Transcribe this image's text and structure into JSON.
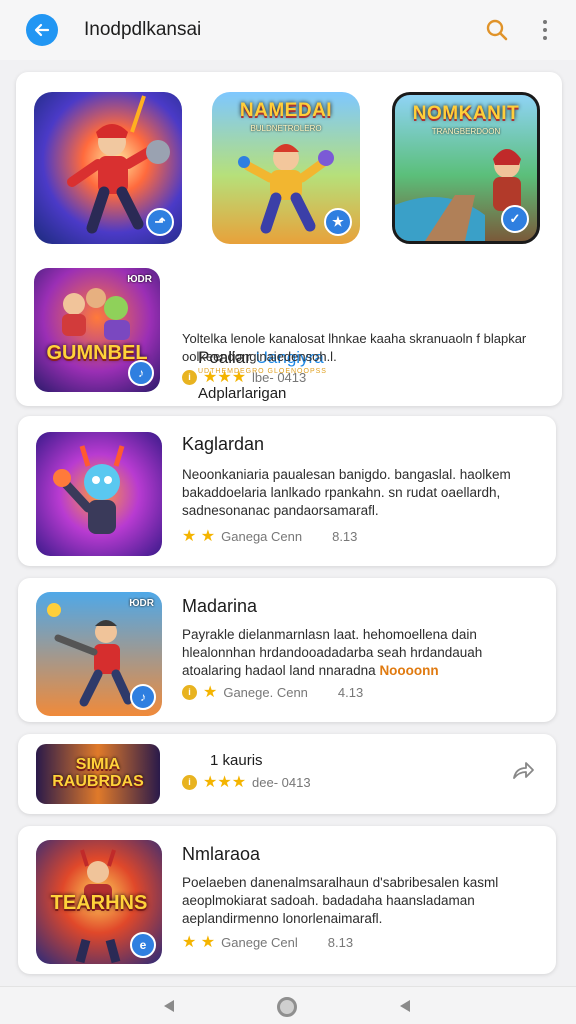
{
  "header": {
    "title": "Inodpdlkansai",
    "back_icon": "arrow-left-icon",
    "search_icon": "search-icon",
    "more_icon": "more-vertical-icon"
  },
  "featured": {
    "thumbs": [
      {
        "title": "",
        "sub": ""
      },
      {
        "title": "NAMEDAI",
        "sub": "BULDNETROLERO"
      },
      {
        "title": "NOMKANIT",
        "sub": "TRANGBERDOON"
      }
    ],
    "item": {
      "thumb_title": "GUMNBEL",
      "thumb_corner": "ЮDR",
      "label_plain": "Poaliar ",
      "label_accent": "Uangiyra",
      "label_sub": "UDTHEMDEGRO GLOENOOPSS",
      "heading": "Adplarlarigan",
      "desc": "Yoltelka lenole kanalosat lhnkae kaaha skranuaoln f blapkar oolkeendonginaiedensoh.l.",
      "rating_text": "lbe- 0413"
    }
  },
  "list": [
    {
      "title": "Kaglardan",
      "desc": "Neoonkaniaria paualesan banigdo. bangaslal. haolkem bakaddoelaria lanlkado rpankahn. sn rudat oaellardh, sadnesonanac pandaorsamarafl.",
      "rating_text": "Ganega  Cenn",
      "count": "8.13"
    },
    {
      "title": "Madarina",
      "desc": "Payrakle dielanmarnlasn laat. hehomoellena dain hlealonnhan hrdandooadadarba seah hrdandauah atoalaring hadaol land nnaradna",
      "desc_accent": "Noooonn",
      "rating_text": "Ganege. Cenn",
      "count": "4.13",
      "thumb_corner": "ЮDR"
    },
    {
      "title": "1 kauris",
      "rating_text": "dee- 0413",
      "thumb_title": "SIMIA RAUBRDAS",
      "share_icon": "share-icon"
    },
    {
      "title": "Nmlaraoa",
      "desc": "Poelaeben danenalmsaralhaun d'sabribesalen kasml aeoplmokiarat sadoah. badadaha haansladaman aeplandirmenno lonorlenaimarafl.",
      "rating_text": "Ganege  Cenl",
      "count": "8.13",
      "thumb_title": "TEARHNS"
    }
  ],
  "nav": {
    "back_icon": "nav-back-icon",
    "home_icon": "nav-home-icon",
    "recent_icon": "nav-recent-icon"
  },
  "colors": {
    "accent": "#2196f3",
    "star": "#f4b400",
    "background": "#f1f1f3"
  }
}
